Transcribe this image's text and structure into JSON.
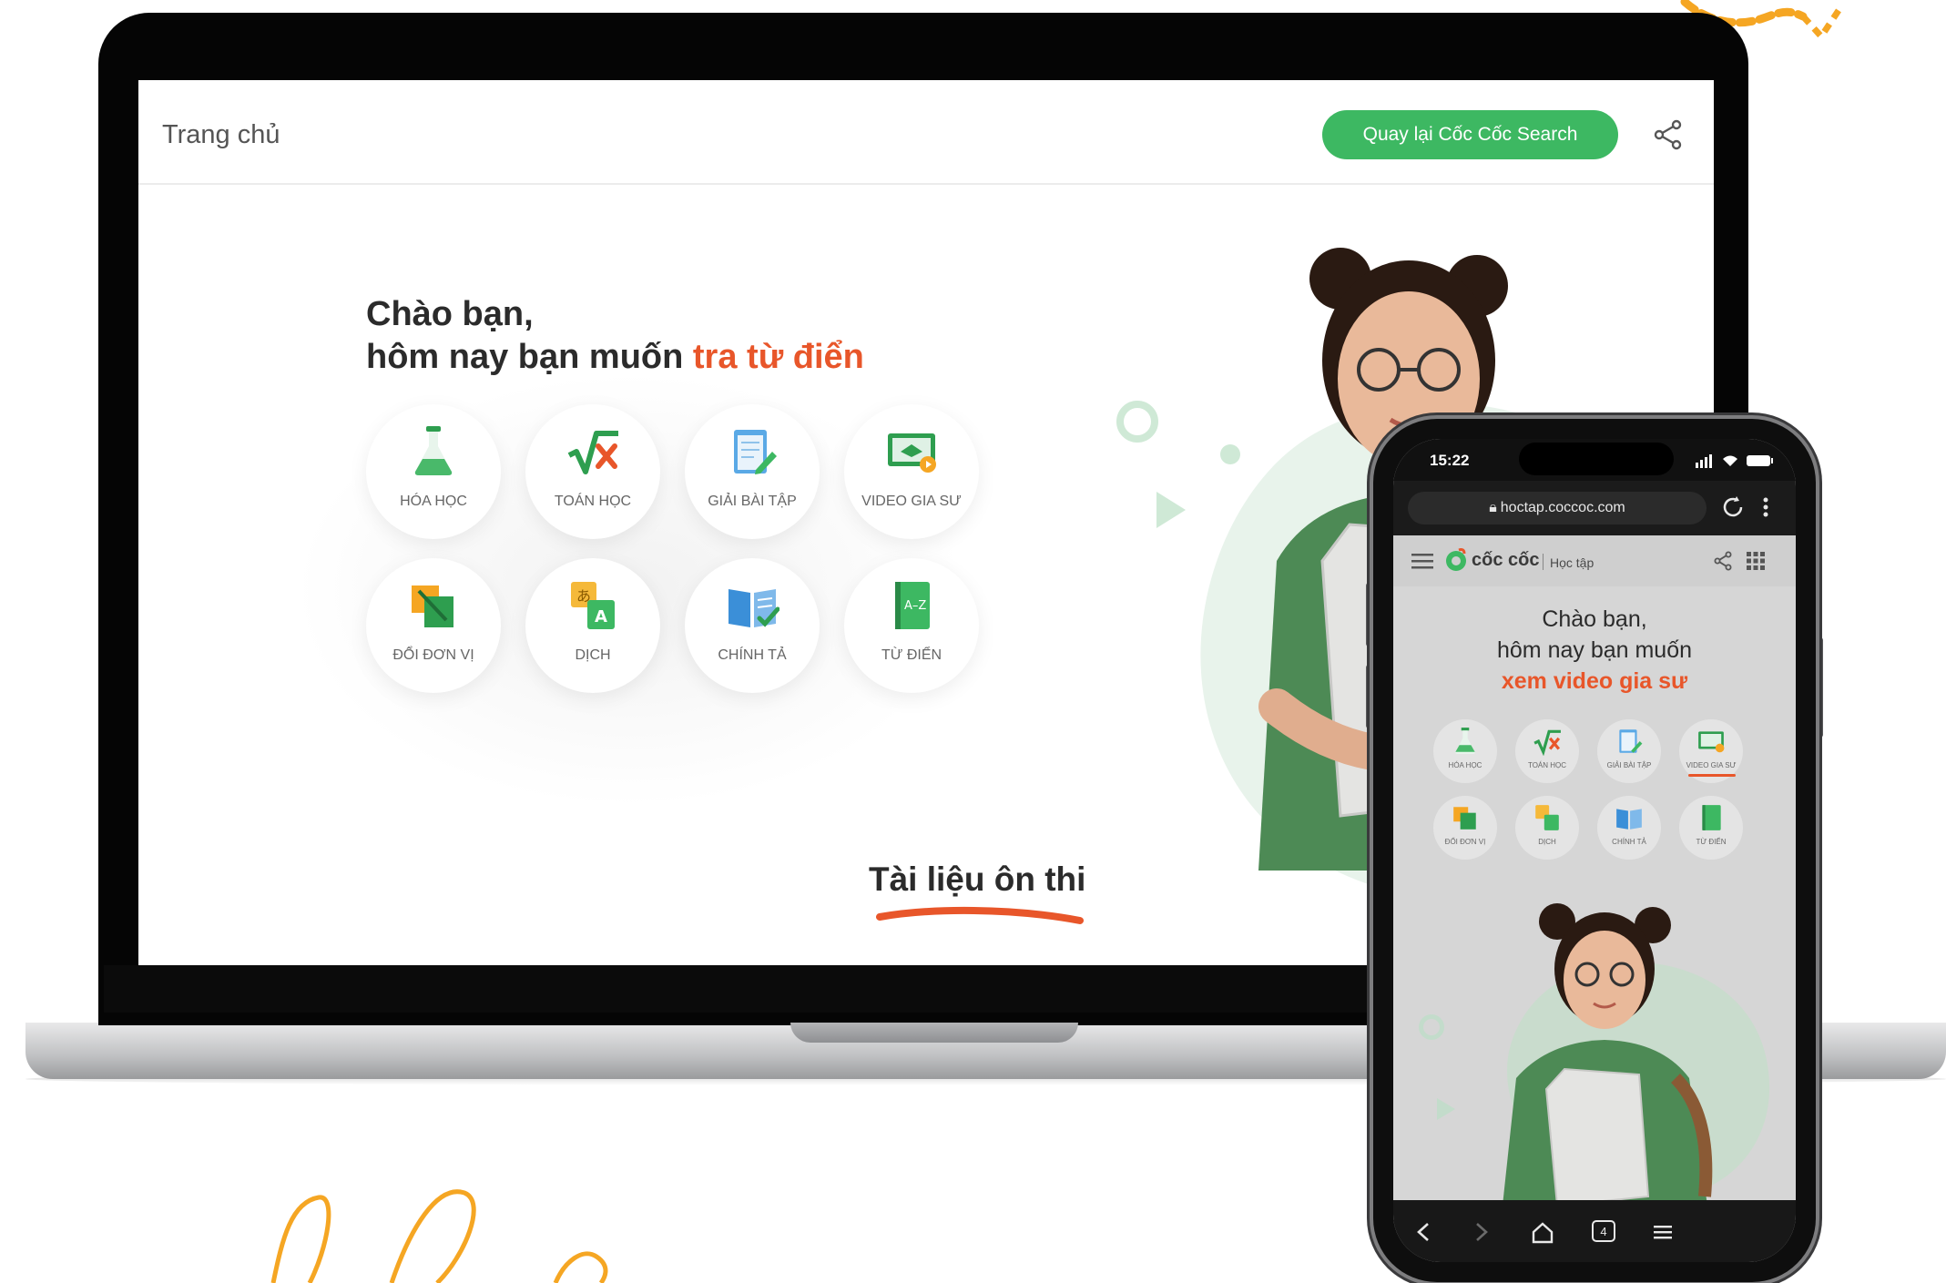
{
  "laptop": {
    "header": {
      "title": "Trang chủ",
      "back_button": "Quay lại Cốc Cốc Search",
      "share_icon": "share-icon"
    },
    "greeting": {
      "line1": "Chào bạn,",
      "line2_prefix": "hôm nay bạn muốn ",
      "line2_highlight": "tra từ điển"
    },
    "categories": [
      {
        "label": "HÓA HỌC",
        "icon": "flask-icon"
      },
      {
        "label": "TOÁN HỌC",
        "icon": "math-sqrt-icon"
      },
      {
        "label": "GIẢI BÀI TẬP",
        "icon": "notepad-pencil-icon"
      },
      {
        "label": "VIDEO GIA SƯ",
        "icon": "video-tutor-icon"
      },
      {
        "label": "ĐỔI ĐƠN VỊ",
        "icon": "ruler-convert-icon"
      },
      {
        "label": "DỊCH",
        "icon": "translate-icon"
      },
      {
        "label": "CHÍNH TẢ",
        "icon": "spelling-book-icon"
      },
      {
        "label": "TỪ ĐIỂN",
        "icon": "dictionary-icon"
      }
    ],
    "section_title": "Tài liệu ôn thi"
  },
  "phone": {
    "status": {
      "time": "15:22"
    },
    "browser": {
      "url": "hoctap.coccoc.com",
      "tabs_count": "4"
    },
    "site": {
      "brand": "cốc cốc",
      "subtitle": "Học tập"
    },
    "greeting": {
      "line1": "Chào bạn,",
      "line2": "hôm nay bạn muốn",
      "line3": "xem video gia sư"
    },
    "categories": [
      {
        "label": "HÓA HỌC",
        "icon": "flask-icon"
      },
      {
        "label": "TOÁN HỌC",
        "icon": "math-sqrt-icon"
      },
      {
        "label": "GIẢI BÀI TẬP",
        "icon": "notepad-pencil-icon"
      },
      {
        "label": "VIDEO GIA SƯ",
        "icon": "video-tutor-icon",
        "active": true
      },
      {
        "label": "ĐỔI ĐƠN VỊ",
        "icon": "ruler-convert-icon"
      },
      {
        "label": "DỊCH",
        "icon": "translate-icon"
      },
      {
        "label": "CHÍNH TẢ",
        "icon": "spelling-book-icon"
      },
      {
        "label": "TỪ ĐIỂN",
        "icon": "dictionary-icon"
      }
    ]
  },
  "colors": {
    "brand_green": "#3db862",
    "highlight_orange": "#e8562a",
    "decoration_orange": "#f5a623"
  }
}
